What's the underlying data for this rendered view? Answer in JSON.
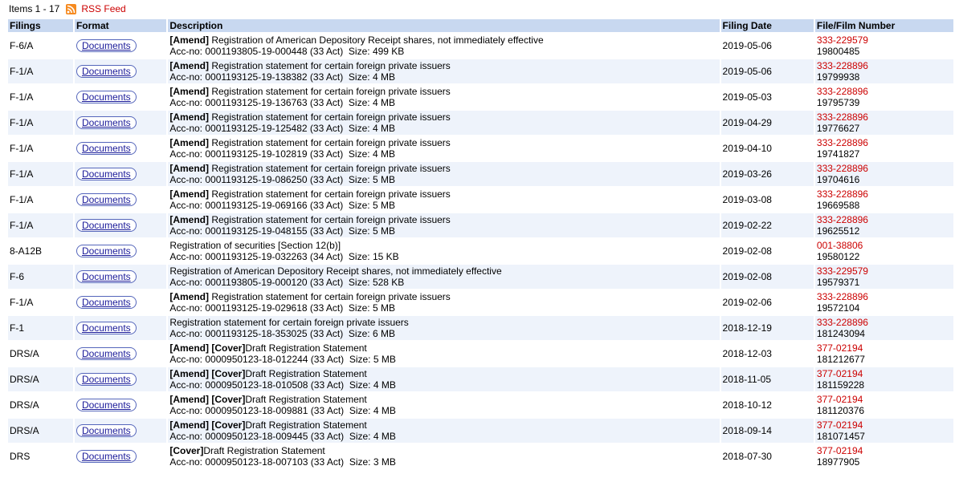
{
  "header": {
    "items_label": "Items 1 - 17",
    "rss_label": "RSS Feed",
    "rss_icon": "rss-icon",
    "rss_color": "#f68a1f"
  },
  "columns": [
    "Filings",
    "Format",
    "Description",
    "Filing Date",
    "File/Film Number"
  ],
  "rows": [
    {
      "filing": "F-6/A",
      "format": "Documents",
      "tag": "[Amend]",
      "cover": "",
      "desc": " Registration of American Depository Receipt shares, not immediately effective",
      "acc": "Acc-no: 0001193805-19-000448 (33 Act)  Size: 499 KB",
      "date": "2019-05-06",
      "file": "333-229579",
      "film": "19800485"
    },
    {
      "filing": "F-1/A",
      "format": "Documents",
      "tag": "[Amend]",
      "cover": "",
      "desc": " Registration statement for certain foreign private issuers",
      "acc": "Acc-no: 0001193125-19-138382 (33 Act)  Size: 4 MB",
      "date": "2019-05-06",
      "file": "333-228896",
      "film": "19799938"
    },
    {
      "filing": "F-1/A",
      "format": "Documents",
      "tag": "[Amend]",
      "cover": "",
      "desc": " Registration statement for certain foreign private issuers",
      "acc": "Acc-no: 0001193125-19-136763 (33 Act)  Size: 4 MB",
      "date": "2019-05-03",
      "file": "333-228896",
      "film": "19795739"
    },
    {
      "filing": "F-1/A",
      "format": "Documents",
      "tag": "[Amend]",
      "cover": "",
      "desc": " Registration statement for certain foreign private issuers",
      "acc": "Acc-no: 0001193125-19-125482 (33 Act)  Size: 4 MB",
      "date": "2019-04-29",
      "file": "333-228896",
      "film": "19776627"
    },
    {
      "filing": "F-1/A",
      "format": "Documents",
      "tag": "[Amend]",
      "cover": "",
      "desc": " Registration statement for certain foreign private issuers",
      "acc": "Acc-no: 0001193125-19-102819 (33 Act)  Size: 4 MB",
      "date": "2019-04-10",
      "file": "333-228896",
      "film": "19741827"
    },
    {
      "filing": "F-1/A",
      "format": "Documents",
      "tag": "[Amend]",
      "cover": "",
      "desc": " Registration statement for certain foreign private issuers",
      "acc": "Acc-no: 0001193125-19-086250 (33 Act)  Size: 5 MB",
      "date": "2019-03-26",
      "file": "333-228896",
      "film": "19704616"
    },
    {
      "filing": "F-1/A",
      "format": "Documents",
      "tag": "[Amend]",
      "cover": "",
      "desc": " Registration statement for certain foreign private issuers",
      "acc": "Acc-no: 0001193125-19-069166 (33 Act)  Size: 5 MB",
      "date": "2019-03-08",
      "file": "333-228896",
      "film": "19669588"
    },
    {
      "filing": "F-1/A",
      "format": "Documents",
      "tag": "[Amend]",
      "cover": "",
      "desc": " Registration statement for certain foreign private issuers",
      "acc": "Acc-no: 0001193125-19-048155 (33 Act)  Size: 5 MB",
      "date": "2019-02-22",
      "file": "333-228896",
      "film": "19625512"
    },
    {
      "filing": "8-A12B",
      "format": "Documents",
      "tag": "",
      "cover": "",
      "desc": "Registration of securities [Section 12(b)]",
      "acc": "Acc-no: 0001193125-19-032263 (34 Act)  Size: 15 KB",
      "date": "2019-02-08",
      "file": "001-38806",
      "film": "19580122"
    },
    {
      "filing": "F-6",
      "format": "Documents",
      "tag": "",
      "cover": "",
      "desc": "Registration of American Depository Receipt shares, not immediately effective",
      "acc": "Acc-no: 0001193805-19-000120 (33 Act)  Size: 528 KB",
      "date": "2019-02-08",
      "file": "333-229579",
      "film": "19579371"
    },
    {
      "filing": "F-1/A",
      "format": "Documents",
      "tag": "[Amend]",
      "cover": "",
      "desc": " Registration statement for certain foreign private issuers",
      "acc": "Acc-no: 0001193125-19-029618 (33 Act)  Size: 5 MB",
      "date": "2019-02-06",
      "file": "333-228896",
      "film": "19572104"
    },
    {
      "filing": "F-1",
      "format": "Documents",
      "tag": "",
      "cover": "",
      "desc": "Registration statement for certain foreign private issuers",
      "acc": "Acc-no: 0001193125-18-353025 (33 Act)  Size: 6 MB",
      "date": "2018-12-19",
      "file": "333-228896",
      "film": "181243094"
    },
    {
      "filing": "DRS/A",
      "format": "Documents",
      "tag": "[Amend]",
      "cover": " [Cover]",
      "desc": "Draft Registration Statement",
      "acc": "Acc-no: 0000950123-18-012244 (33 Act)  Size: 5 MB",
      "date": "2018-12-03",
      "file": "377-02194",
      "film": "181212677"
    },
    {
      "filing": "DRS/A",
      "format": "Documents",
      "tag": "[Amend]",
      "cover": " [Cover]",
      "desc": "Draft Registration Statement",
      "acc": "Acc-no: 0000950123-18-010508 (33 Act)  Size: 4 MB",
      "date": "2018-11-05",
      "file": "377-02194",
      "film": "181159228"
    },
    {
      "filing": "DRS/A",
      "format": "Documents",
      "tag": "[Amend]",
      "cover": " [Cover]",
      "desc": "Draft Registration Statement",
      "acc": "Acc-no: 0000950123-18-009881 (33 Act)  Size: 4 MB",
      "date": "2018-10-12",
      "file": "377-02194",
      "film": "181120376"
    },
    {
      "filing": "DRS/A",
      "format": "Documents",
      "tag": "[Amend]",
      "cover": " [Cover]",
      "desc": "Draft Registration Statement",
      "acc": "Acc-no: 0000950123-18-009445 (33 Act)  Size: 4 MB",
      "date": "2018-09-14",
      "file": "377-02194",
      "film": "181071457"
    },
    {
      "filing": "DRS",
      "format": "Documents",
      "tag": "",
      "cover": "[Cover]",
      "desc": "Draft Registration Statement",
      "acc": "Acc-no: 0000950123-18-007103 (33 Act)  Size: 3 MB",
      "date": "2018-07-30",
      "file": "377-02194",
      "film": "18977905"
    }
  ]
}
